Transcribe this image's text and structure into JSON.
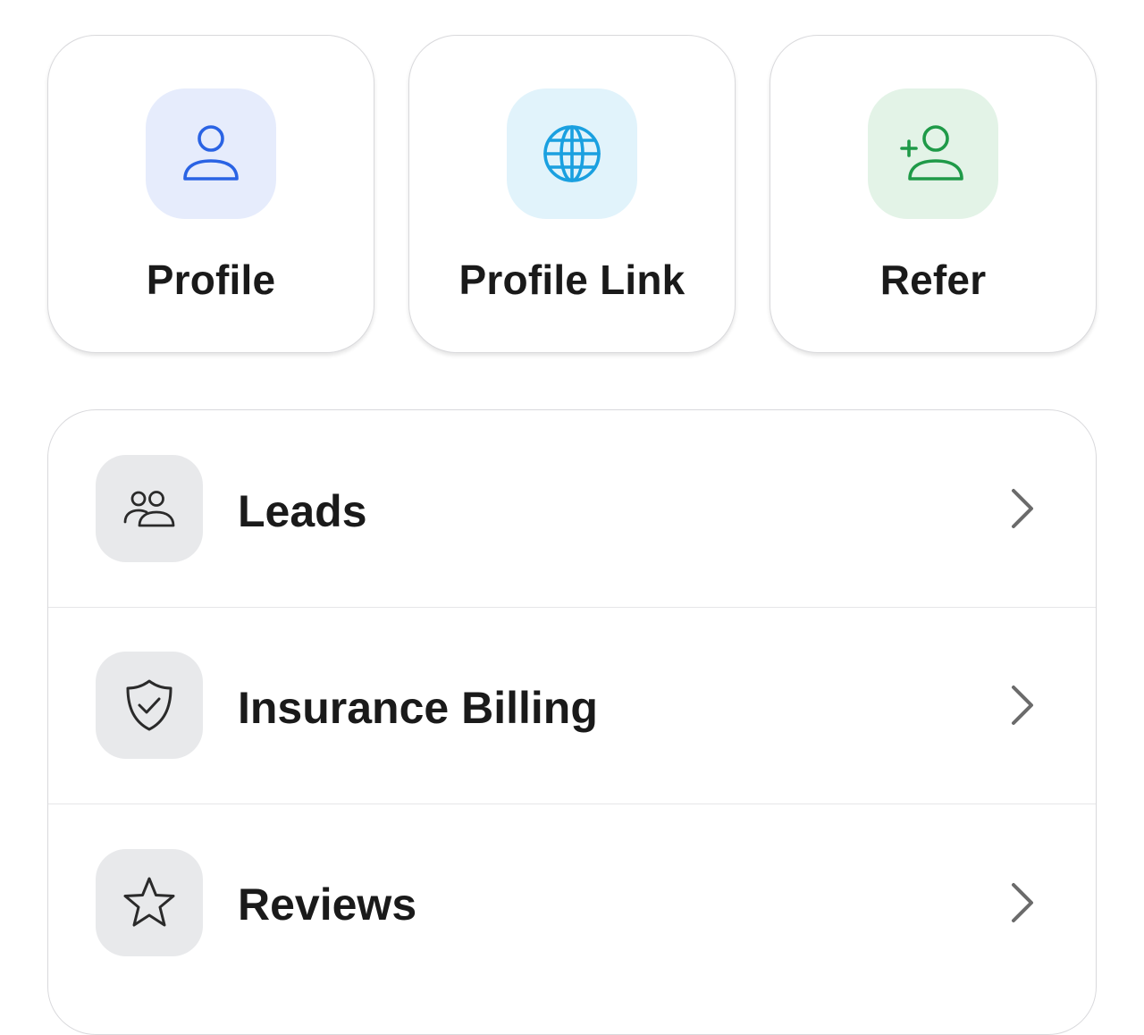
{
  "quick_actions": [
    {
      "label": "Profile",
      "icon": "user-icon",
      "accent": "#2a63e4",
      "background": "#e6ecfc"
    },
    {
      "label": "Profile Link",
      "icon": "globe-icon",
      "accent": "#1aa0e0",
      "background": "#e1f3fb"
    },
    {
      "label": "Refer",
      "icon": "add-user-icon",
      "accent": "#1f9a48",
      "background": "#e3f3e7"
    }
  ],
  "menu": {
    "items": [
      {
        "label": "Leads",
        "icon": "users-icon"
      },
      {
        "label": "Insurance Billing",
        "icon": "shield-check-icon"
      },
      {
        "label": "Reviews",
        "icon": "star-icon"
      }
    ]
  },
  "colors": {
    "text": "#1a1a1a",
    "menu_icon_bg": "#e8e9eb",
    "chevron": "#6b6b6b",
    "border": "#d9d9dc"
  }
}
